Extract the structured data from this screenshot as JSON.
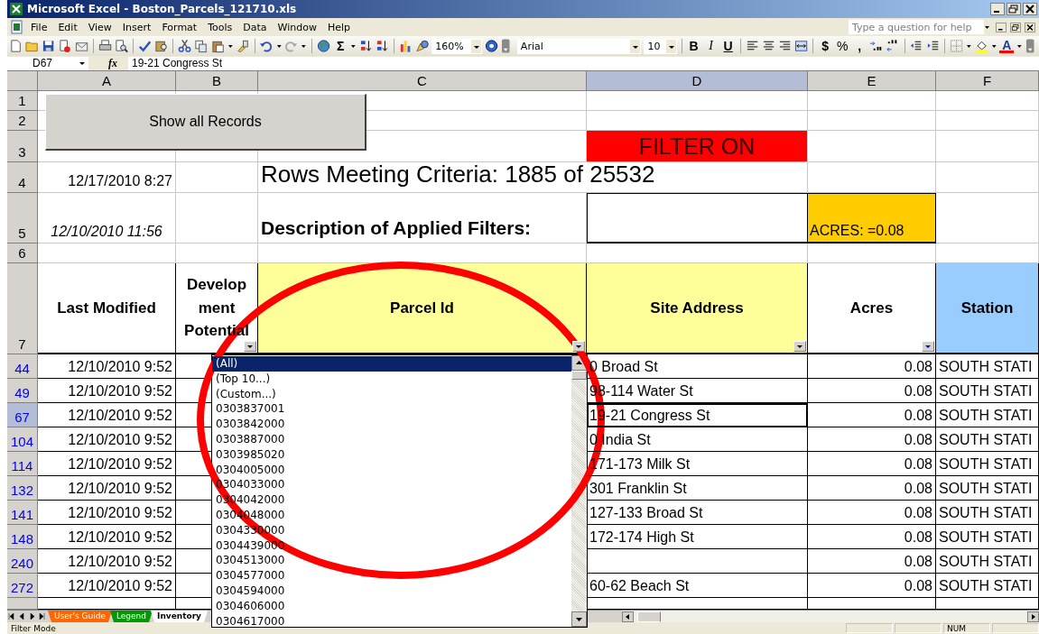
{
  "window": {
    "title": "Microsoft Excel - Boston_Parcels_121710.xls"
  },
  "menu": {
    "items": [
      "File",
      "Edit",
      "View",
      "Insert",
      "Format",
      "Tools",
      "Data",
      "Window",
      "Help"
    ],
    "help_placeholder": "Type a question for help"
  },
  "toolbar": {
    "items": [
      {
        "kind": "icon",
        "caret": false
      },
      {
        "kind": "icon",
        "caret": false
      },
      {
        "kind": "icon",
        "caret": false
      },
      {
        "kind": "icon",
        "caret": false
      },
      {
        "kind": "icon",
        "caret": false
      },
      {
        "kind": "separator"
      },
      {
        "kind": "icon",
        "caret": false
      },
      {
        "kind": "icon",
        "caret": false
      },
      {
        "kind": "separator"
      },
      {
        "kind": "icon",
        "caret": false
      },
      {
        "kind": "icon",
        "caret": false
      },
      {
        "kind": "separator"
      },
      {
        "kind": "icon",
        "caret": false
      },
      {
        "kind": "icon",
        "caret": false
      },
      {
        "kind": "icon",
        "caret": true
      },
      {
        "kind": "icon",
        "caret": false
      },
      {
        "kind": "separator"
      },
      {
        "kind": "icon",
        "caret": true
      },
      {
        "kind": "icon",
        "caret": true
      },
      {
        "kind": "separator"
      },
      {
        "kind": "icon",
        "caret": false
      },
      {
        "kind": "bold-glyph",
        "label": "Σ",
        "caret": true
      },
      {
        "kind": "icon",
        "caret": false
      },
      {
        "kind": "icon",
        "caret": false
      },
      {
        "kind": "separator"
      },
      {
        "kind": "icon",
        "caret": false
      },
      {
        "kind": "icon",
        "caret": false
      },
      {
        "kind": "combo",
        "value": "160%"
      },
      {
        "kind": "icon",
        "caret": false
      },
      {
        "kind": "icon",
        "caret": false
      },
      {
        "kind": "combo",
        "value": "Arial"
      },
      {
        "kind": "combo",
        "value": "10"
      },
      {
        "kind": "separator"
      },
      {
        "kind": "bold-glyph",
        "label": "B",
        "caret": false
      },
      {
        "kind": "italic-glyph",
        "label": "I",
        "caret": false
      },
      {
        "kind": "underline-glyph",
        "label": "U",
        "caret": false
      },
      {
        "kind": "separator"
      },
      {
        "kind": "icon",
        "caret": false
      },
      {
        "kind": "icon",
        "caret": false
      },
      {
        "kind": "icon",
        "caret": false
      },
      {
        "kind": "icon",
        "caret": false
      },
      {
        "kind": "separator"
      },
      {
        "kind": "bold-glyph",
        "label": "$",
        "caret": false
      },
      {
        "kind": "glyph",
        "label": "%",
        "caret": false
      },
      {
        "kind": "bold-glyph",
        "label": ",",
        "caret": false
      },
      {
        "kind": "icon",
        "caret": false
      },
      {
        "kind": "icon",
        "caret": false
      },
      {
        "kind": "separator"
      },
      {
        "kind": "icon",
        "caret": false
      },
      {
        "kind": "icon",
        "caret": false
      },
      {
        "kind": "separator"
      },
      {
        "kind": "icon",
        "caret": true
      },
      {
        "kind": "icon",
        "caret": true
      },
      {
        "kind": "color-glyph",
        "label": "A",
        "caret": true
      },
      {
        "kind": "icon",
        "caret": false
      }
    ]
  },
  "formula_bar": {
    "name_box": "D67",
    "function_label": "fx",
    "content": "19-21 Congress St"
  },
  "sheet": {
    "columns": [
      {
        "label": "A",
        "selected": false
      },
      {
        "label": "B",
        "selected": false
      },
      {
        "label": "C",
        "selected": false
      },
      {
        "label": "D",
        "selected": true
      },
      {
        "label": "E",
        "selected": false
      },
      {
        "label": "F",
        "selected": false
      }
    ],
    "top_row_numbers": [
      "1",
      "2",
      "3",
      "4",
      "5",
      "6",
      "7"
    ],
    "filter_status": "FILTER ON",
    "last_updated": "12/17/2010 8:27",
    "criteria": "Rows Meeting Criteria: 1885 of 25532",
    "data_date": "12/10/2010 11:56",
    "description_label": "Description of Applied Filters:",
    "applied_filter": "ACRES: =0.08",
    "headers": [
      {
        "label": "Last Modified",
        "color": "#ffffff",
        "filter_button": false
      },
      {
        "label": "Development Potential",
        "color": "#ffffff",
        "filter_button": true,
        "filtered": false
      },
      {
        "label": "Parcel Id",
        "color": "#ffff99",
        "filter_button": true,
        "filtered": false
      },
      {
        "label": "Site Address",
        "color": "#ffff99",
        "filter_button": true,
        "filtered": false
      },
      {
        "label": "Acres",
        "color": "#ffffff",
        "filter_button": true,
        "filtered": true
      },
      {
        "label": "Station",
        "color": "#99ccff",
        "filter_button": false
      }
    ],
    "rows": [
      {
        "number": "44",
        "selected": false,
        "modified": "12/10/2010 9:52",
        "address": "0 Broad St",
        "acres": "0.08",
        "station": "SOUTH STATI"
      },
      {
        "number": "49",
        "selected": false,
        "modified": "12/10/2010 9:52",
        "address": "98-114 Water St",
        "acres": "0.08",
        "station": "SOUTH STATI"
      },
      {
        "number": "67",
        "selected": true,
        "modified": "12/10/2010 9:52",
        "address": "19-21 Congress St",
        "acres": "0.08",
        "station": "SOUTH STATI"
      },
      {
        "number": "104",
        "selected": false,
        "modified": "12/10/2010 9:52",
        "address": "0 India St",
        "acres": "0.08",
        "station": "SOUTH STATI"
      },
      {
        "number": "114",
        "selected": false,
        "modified": "12/10/2010 9:52",
        "address": "171-173 Milk St",
        "acres": "0.08",
        "station": "SOUTH STATI"
      },
      {
        "number": "132",
        "selected": false,
        "modified": "12/10/2010 9:52",
        "address": "301 Franklin St",
        "acres": "0.08",
        "station": "SOUTH STATI"
      },
      {
        "number": "141",
        "selected": false,
        "modified": "12/10/2010 9:52",
        "address": "127-133 Broad St",
        "acres": "0.08",
        "station": "SOUTH STATI"
      },
      {
        "number": "148",
        "selected": false,
        "modified": "12/10/2010 9:52",
        "address": "172-174 High St",
        "acres": "0.08",
        "station": "SOUTH STATI"
      },
      {
        "number": "240",
        "selected": false,
        "modified": "12/10/2010 9:52",
        "acres": "0.08",
        "station": "SOUTH STATI"
      },
      {
        "number": "272",
        "selected": false,
        "modified": "12/10/2010 9:52",
        "address": "60-62 Beach St",
        "acres": "0.08",
        "station": "SOUTH STATI"
      }
    ]
  },
  "show_all_button": {
    "label": "Show all Records"
  },
  "filter_dropdown": {
    "items": [
      {
        "label": "(All)",
        "selected": true
      },
      {
        "label": "(Top 10...)",
        "selected": false
      },
      {
        "label": "(Custom...)",
        "selected": false
      },
      {
        "label": "0303837001",
        "selected": false
      },
      {
        "label": "0303842000",
        "selected": false
      },
      {
        "label": "0303887000",
        "selected": false
      },
      {
        "label": "0303985020",
        "selected": false
      },
      {
        "label": "0304005000",
        "selected": false
      },
      {
        "label": "0304033000",
        "selected": false
      },
      {
        "label": "0304042000",
        "selected": false
      },
      {
        "label": "0304048000",
        "selected": false
      },
      {
        "label": "0304330000",
        "selected": false
      },
      {
        "label": "0304439000",
        "selected": false
      },
      {
        "label": "0304513000",
        "selected": false
      },
      {
        "label": "0304577000",
        "selected": false
      },
      {
        "label": "0304594000",
        "selected": false
      },
      {
        "label": "0304606000",
        "selected": false
      },
      {
        "label": "0304617000",
        "selected": false
      }
    ]
  },
  "sheet_tabs": [
    {
      "label": "User's Guide",
      "color": "#ff6600",
      "selected": false
    },
    {
      "label": "Legend",
      "color": "#009900",
      "selected": false
    },
    {
      "label": "Inventory",
      "selected": true
    }
  ],
  "status_bar": {
    "mode": "Filter Mode",
    "indicator": "NUM"
  }
}
